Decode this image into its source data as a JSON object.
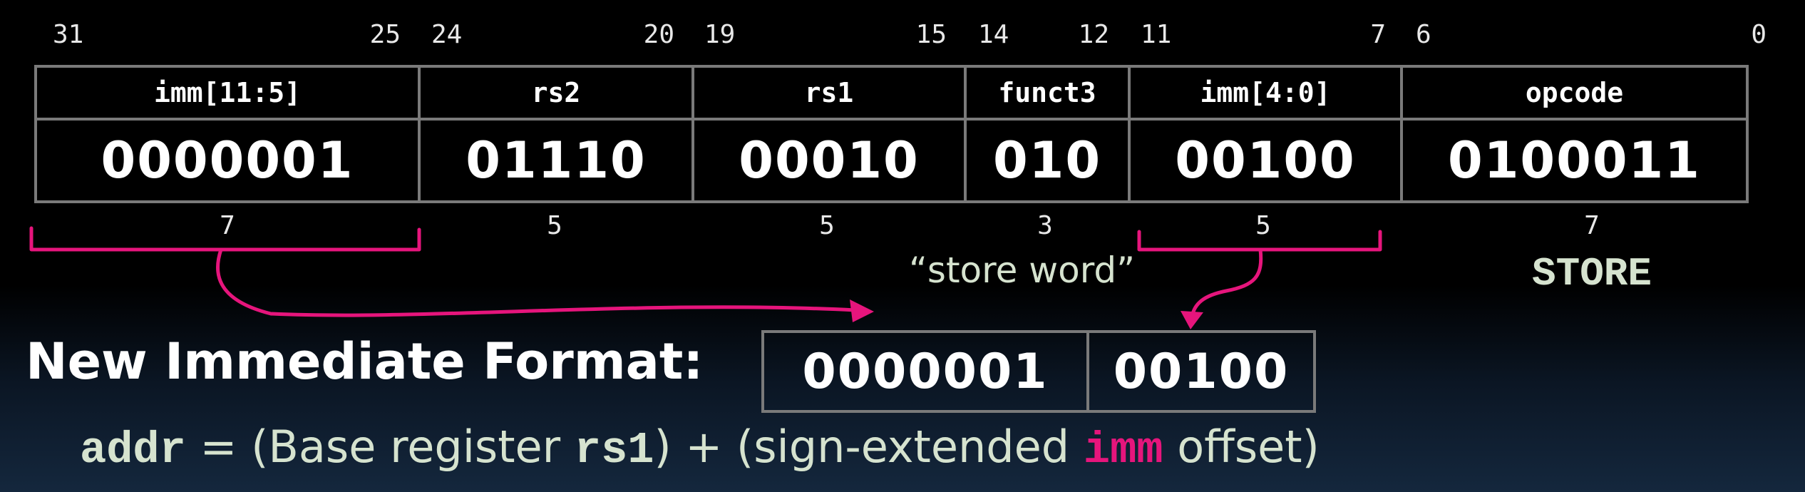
{
  "bit_positions": {
    "b31": "31",
    "b25": "25",
    "b24": "24",
    "b20": "20",
    "b19": "19",
    "b15": "15",
    "b14": "14",
    "b12": "12",
    "b11": "11",
    "b7": "7",
    "b6": "6",
    "b0": "0"
  },
  "fields": [
    {
      "name": "imm[11:5]",
      "value": "0000001",
      "width": "7"
    },
    {
      "name": "rs2",
      "value": "01110",
      "width": "5"
    },
    {
      "name": "rs1",
      "value": "00010",
      "width": "5"
    },
    {
      "name": "funct3",
      "value": "010",
      "width": "3"
    },
    {
      "name": "imm[4:0]",
      "value": "00100",
      "width": "5"
    },
    {
      "name": "opcode",
      "value": "0100011",
      "width": "7"
    }
  ],
  "annotations": {
    "funct3_meaning": "“store word”",
    "opcode_meaning": "STORE"
  },
  "new_immediate": {
    "title": "New Immediate Format:",
    "upper": "0000001",
    "lower": "00100"
  },
  "formula": {
    "addr": "addr",
    "eq_base": " = (Base register ",
    "rs1": "rs1",
    "plus_sign": ") + (sign-extended ",
    "imm": "imm",
    "offset": " offset)"
  },
  "colors": {
    "accent_pink": "#e6157c",
    "text_green": "#d6e3cf",
    "border_gray": "#7a7a7a"
  }
}
